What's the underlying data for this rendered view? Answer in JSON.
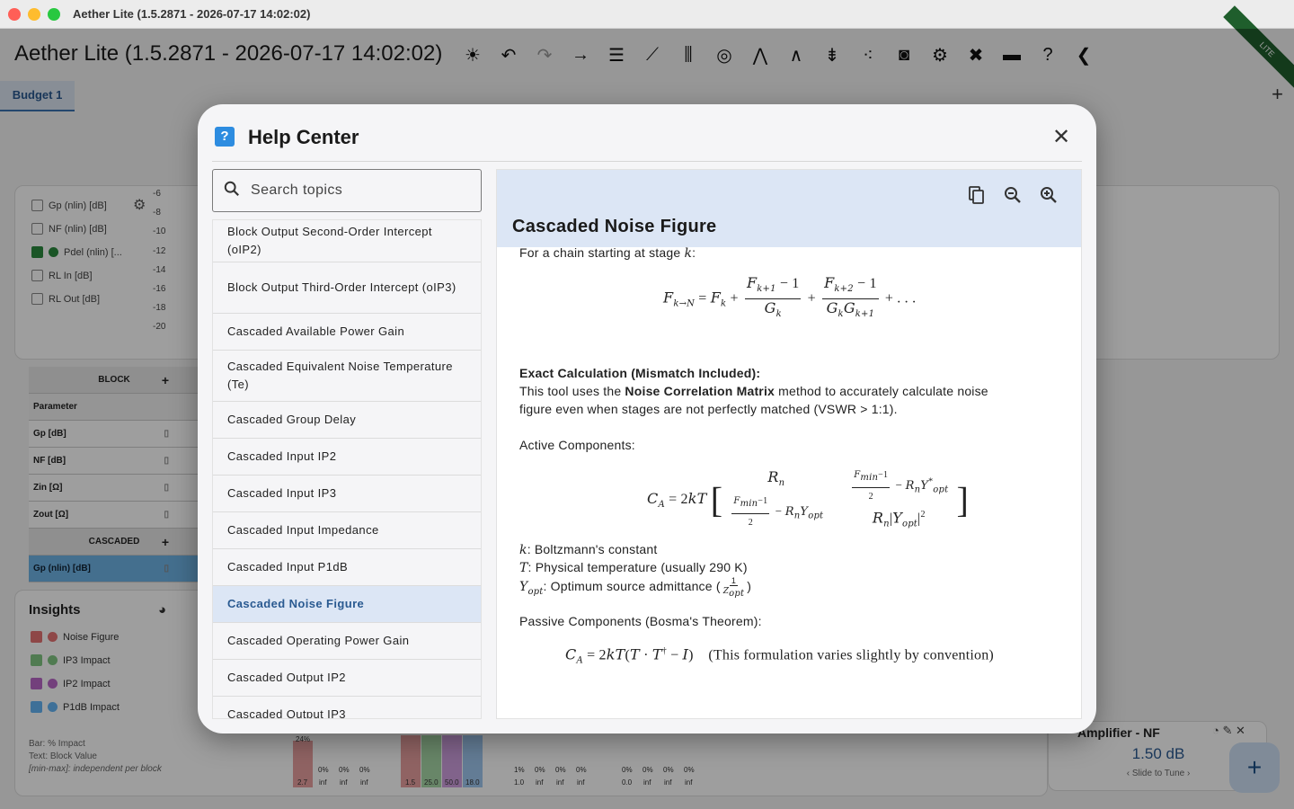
{
  "window": {
    "title": "Aether Lite (1.5.2871 - 2026-07-17 14:02:02)"
  },
  "app": {
    "title": "Aether Lite (1.5.2871 - 2026-07-17 14:02:02)",
    "ribbon": "LITE",
    "tab": "Budget 1",
    "toolbar_icons": [
      "brightness-icon",
      "undo-icon",
      "redo-icon",
      "arrow-right-icon",
      "table-icon",
      "line-chart-icon",
      "waveform-icon",
      "target-icon",
      "antenna-icon",
      "curve-icon",
      "align-icon",
      "scatter-icon",
      "camera-icon",
      "gear-icon",
      "tools-icon",
      "folder-icon",
      "help-icon",
      "cursor-icon"
    ]
  },
  "chart_legend": [
    {
      "label": "Gp (nlin) [dB]",
      "checked": false
    },
    {
      "label": "NF (nlin) [dB]",
      "checked": false
    },
    {
      "label": "Pdel (nlin) [...",
      "checked": true,
      "color": "#2b8a3e"
    },
    {
      "label": "RL In [dB]",
      "checked": false
    },
    {
      "label": "RL Out [dB]",
      "checked": false
    }
  ],
  "y_ticks": [
    "-6",
    "-8",
    "-10",
    "-12",
    "-14",
    "-16",
    "-18",
    "-20"
  ],
  "block_table": {
    "block_header": "BLOCK",
    "parameter": "Parameter",
    "rows": [
      "Gp [dB]",
      "NF [dB]",
      "Zin [Ω]",
      "Zout [Ω]"
    ],
    "cascaded_header": "CASCADED",
    "selected_row": "Gp (nlin) [dB]"
  },
  "insights": {
    "title": "Insights",
    "items": [
      {
        "label": "Noise Figure",
        "color": "#e57373"
      },
      {
        "label": "IP3 Impact",
        "color": "#81c784"
      },
      {
        "label": "IP2 Impact",
        "color": "#ba68c8"
      },
      {
        "label": "P1dB Impact",
        "color": "#64b5f6"
      }
    ],
    "note1": "Bar: % Impact",
    "note2": "Text: Block Value",
    "note3": "[min-max]: independent per block"
  },
  "bars": {
    "pct_labels": [
      "24%",
      "0%",
      "0%",
      "0%",
      "1%",
      "0%",
      "0%",
      "0%",
      "0%",
      "0%",
      "0%",
      "0%"
    ],
    "value_labels": [
      "2.7",
      "inf",
      "inf",
      "inf",
      "1.5",
      "25.0",
      "50.0",
      "18.0",
      "1.0",
      "inf",
      "inf",
      "inf",
      "0.0",
      "inf",
      "inf",
      "inf"
    ]
  },
  "nf_card": {
    "title": "Amplifier - NF",
    "value": "1.50 dB",
    "hint": "Slide to Tune"
  },
  "dialog": {
    "title": "Help Center",
    "search_placeholder": "Search topics",
    "topics": [
      "Block Output Second-Order Intercept (oIP2)",
      "Block Output Third-Order Intercept (oIP3)",
      "Cascaded Available Power Gain",
      "Cascaded Equivalent Noise Temperature (Te)",
      "Cascaded Group Delay",
      "Cascaded Input IP2",
      "Cascaded Input IP3",
      "Cascaded Input Impedance",
      "Cascaded Input P1dB",
      "Cascaded Noise Figure",
      "Cascaded Operating Power Gain",
      "Cascaded Output IP2",
      "Cascaded Output IP3"
    ],
    "active_topic": "Cascaded Noise Figure",
    "content": {
      "title": "Cascaded Noise Figure",
      "intro": "For a chain starting at stage ",
      "intro_var": "k",
      "exact_heading": "Exact Calculation (Mismatch Included):",
      "exact_text1": "This tool uses the ",
      "exact_bold": "Noise Correlation Matrix",
      "exact_text2": " method to accurately calculate noise",
      "exact_text3": "figure even when stages are not perfectly matched (VSWR > 1:1).",
      "active_heading": "Active Components:",
      "def_k": ": Boltzmann's constant",
      "def_T": ": Physical temperature (usually 290 K)",
      "def_Y": ": Optimum source admittance (",
      "passive_heading": "Passive Components (Bosma's Theorem):",
      "passive_note": "(This formulation varies slightly by convention)"
    }
  }
}
